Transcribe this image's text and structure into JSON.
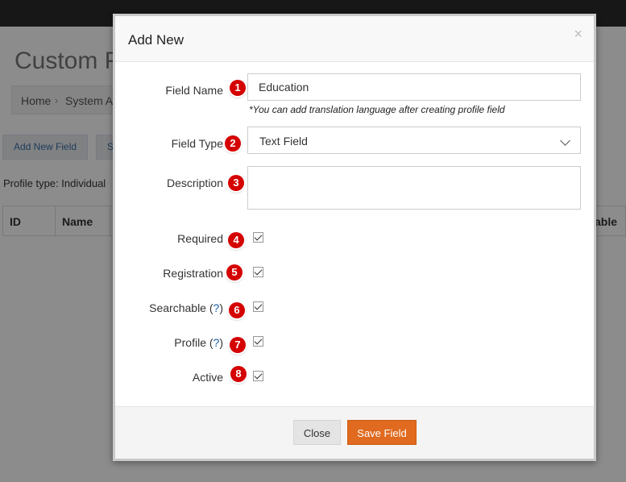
{
  "page": {
    "title": "Custom P",
    "breadcrumb": {
      "home": "Home",
      "current": "System Ad"
    },
    "buttons": {
      "add_new_field": "Add New Field",
      "second": "S"
    },
    "profile_type": "Profile type: Individual",
    "table_headers": {
      "id": "ID",
      "name": "Name",
      "last": "able"
    }
  },
  "modal": {
    "title": "Add New",
    "close_symbol": "×",
    "badges": [
      "1",
      "2",
      "3",
      "4",
      "5",
      "6",
      "7",
      "8"
    ],
    "fields": {
      "field_name": {
        "label": "Field Name",
        "value": "Education",
        "hint": "*You can add translation language after creating profile field"
      },
      "field_type": {
        "label": "Field Type",
        "value": "Text Field"
      },
      "description": {
        "label": "Description",
        "value": ""
      },
      "required": {
        "label": "Required",
        "checked": true
      },
      "registration": {
        "label": "Registration",
        "checked": true
      },
      "searchable": {
        "label": "Searchable (",
        "q": "?",
        "end": ")",
        "checked": true
      },
      "profile": {
        "label": "Profile (",
        "q": "?",
        "end": ")",
        "checked": true
      },
      "active": {
        "label": "Active",
        "checked": true
      }
    },
    "footer": {
      "close_label": "Close",
      "save_label": "Save Field"
    }
  },
  "colors": {
    "save_button": "#e06a1f",
    "badge": "#d50000",
    "link": "#1a5ea8",
    "topbar": "#2b2b2b"
  }
}
